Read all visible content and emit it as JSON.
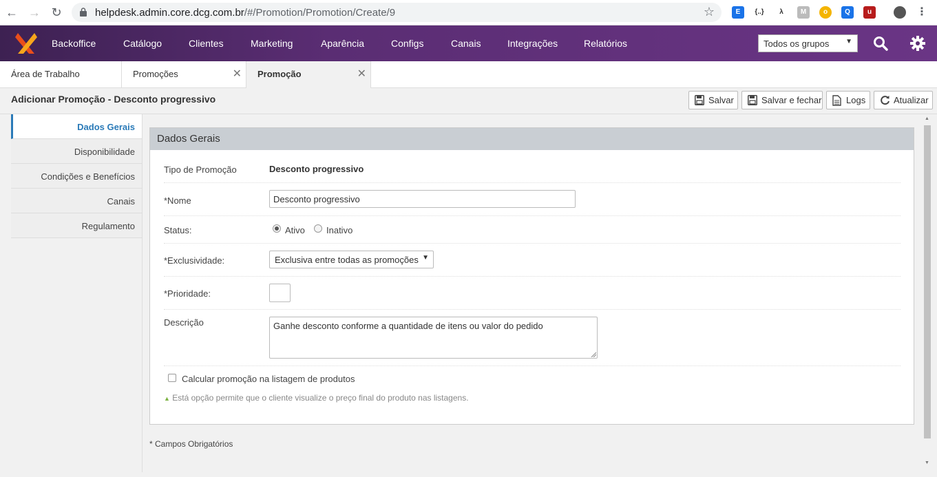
{
  "browser": {
    "url_host": "helpdesk.admin.core.dcg.com.br",
    "url_path": "/#/Promotion/Promotion/Create/9"
  },
  "header": {
    "menu": [
      "Backoffice",
      "Catálogo",
      "Clientes",
      "Marketing",
      "Aparência",
      "Configs",
      "Canais",
      "Integrações",
      "Relatórios"
    ],
    "group_select": "Todos os grupos"
  },
  "tabs": [
    {
      "label": "Área de Trabalho"
    },
    {
      "label": "Promoções"
    },
    {
      "label": "Promoção"
    }
  ],
  "page": {
    "title": "Adicionar Promoção - Desconto progressivo",
    "toolbar": {
      "save": "Salvar",
      "save_close": "Salvar e fechar",
      "logs": "Logs",
      "refresh": "Atualizar"
    }
  },
  "sidebar": {
    "items": [
      "Dados Gerais",
      "Disponibilidade",
      "Condições e Benefícios",
      "Canais",
      "Regulamento"
    ]
  },
  "form": {
    "section_title": "Dados Gerais",
    "type_label": "Tipo de Promoção",
    "type_value": "Desconto progressivo",
    "name_label": "*Nome",
    "name_value": "Desconto progressivo",
    "status_label": "Status:",
    "status_active": "Ativo",
    "status_inactive": "Inativo",
    "exclusivity_label": "*Exclusividade:",
    "exclusivity_value": "Exclusiva entre todas as promoções",
    "priority_label": "*Prioridade:",
    "description_label": "Descrição",
    "description_value": "Ganhe desconto conforme a quantidade de itens ou valor do pedido",
    "calc_label": "Calcular promoção na listagem de produtos",
    "calc_hint": "Está opção permite que o cliente visualize o preço final do produto nas listagens."
  },
  "footnote": "* Campos Obrigatórios"
}
